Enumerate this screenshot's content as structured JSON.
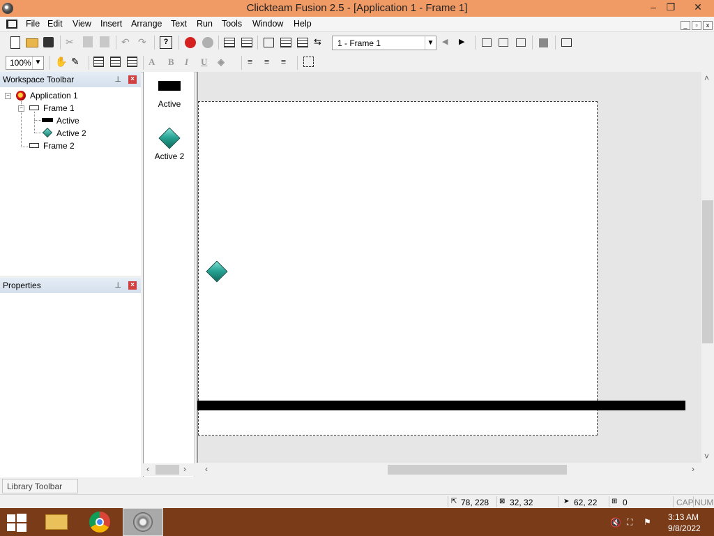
{
  "window": {
    "title": "Clickteam Fusion 2.5 - [Application 1 - Frame 1]",
    "minimize_glyph": "–",
    "restore_glyph": "❐",
    "close_glyph": "✕"
  },
  "menu": {
    "items": [
      "File",
      "Edit",
      "View",
      "Insert",
      "Arrange",
      "Text",
      "Run",
      "Tools",
      "Window",
      "Help"
    ]
  },
  "toolbar": {
    "frame_select": "1 - Frame 1",
    "zoom": "100%"
  },
  "workspace": {
    "title": "Workspace Toolbar",
    "tree": {
      "application": "Application 1",
      "frame1": "Frame 1",
      "obj_active": "Active",
      "obj_active2": "Active 2",
      "frame2": "Frame 2"
    }
  },
  "properties": {
    "title": "Properties"
  },
  "palette": {
    "items": [
      "Active",
      "Active 2"
    ]
  },
  "library": {
    "tab_label": "Library Toolbar"
  },
  "status": {
    "cursor_pos": "78, 228",
    "size": "32, 32",
    "hotspot": "62, 22",
    "count": "0",
    "caps": "CAP",
    "num": "NUM"
  },
  "taskbar": {
    "time": "3:13 AM",
    "date": "9/8/2022"
  },
  "colors": {
    "titlebar": "#f09a65",
    "taskbar": "#7a3b18",
    "diamond": "#1e9484"
  }
}
